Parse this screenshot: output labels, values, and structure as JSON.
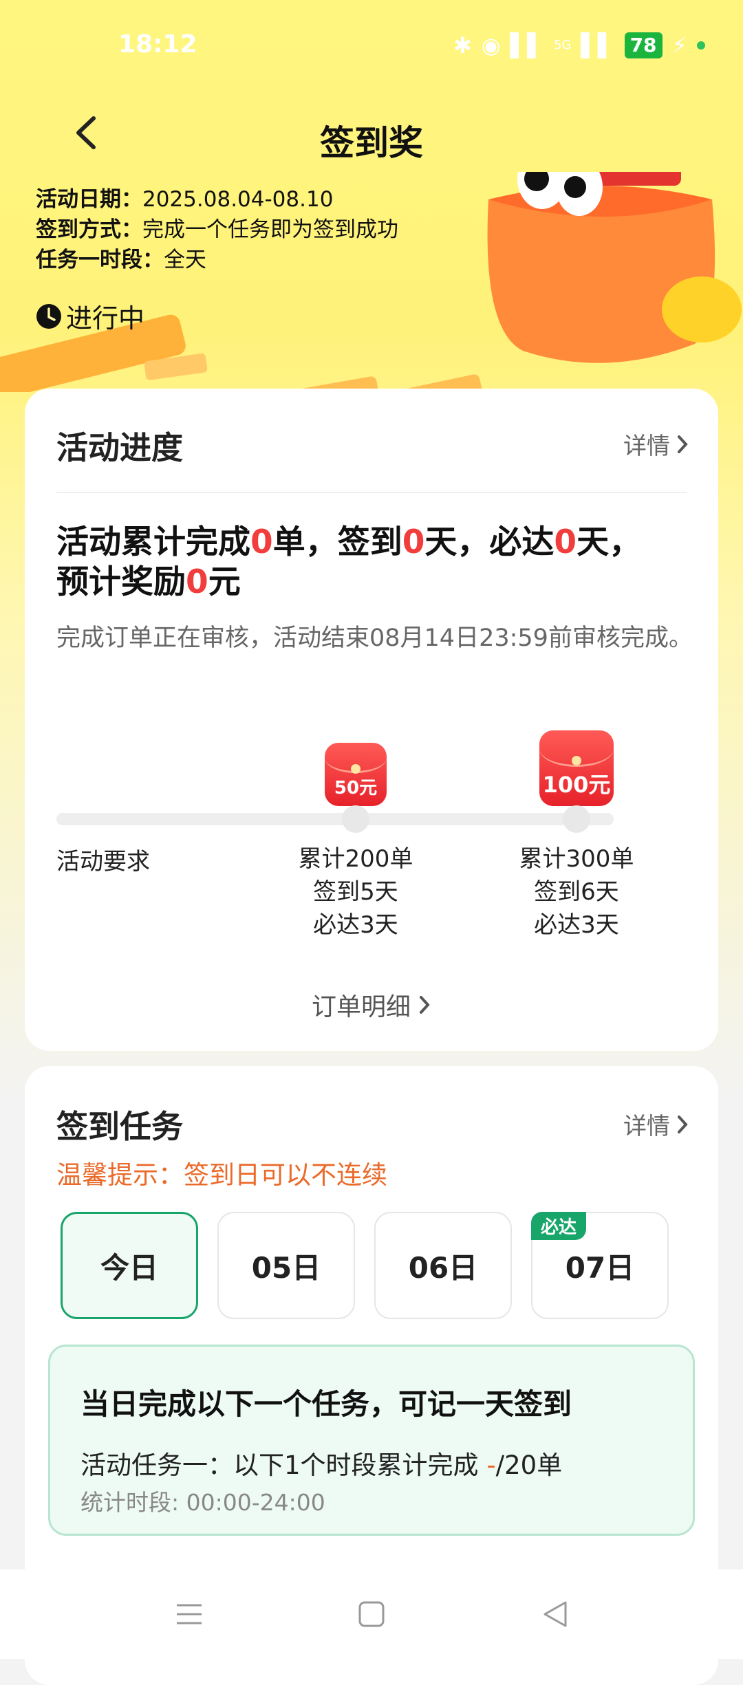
{
  "status_bar": {
    "time": "18:12",
    "battery": "78",
    "network": "5G"
  },
  "header": {
    "title": "签到奖"
  },
  "banner": {
    "date_label": "活动日期：",
    "date_value": "2025.08.04-08.10",
    "method_label": "签到方式：",
    "method_value": "完成一个任务即为签到成功",
    "period_label": "任务一时段：",
    "period_value": "全天",
    "status": "进行中"
  },
  "progress": {
    "title": "活动进度",
    "detail": "详情",
    "summary_parts": [
      "活动累计完成",
      "0",
      "单，签到",
      "0",
      "天，必达",
      "0",
      "天，",
      "预计奖励",
      "0",
      "元"
    ],
    "audit_note": "完成订单正在审核，活动结束08月14日23:59前审核完成。",
    "requirement_label": "活动要求",
    "milestones": [
      {
        "reward": "50元",
        "orders": "累计200单",
        "signin": "签到5天",
        "must": "必达3天"
      },
      {
        "reward": "100元",
        "orders": "累计300单",
        "signin": "签到6天",
        "must": "必达3天"
      }
    ],
    "order_detail": "订单明细"
  },
  "signin": {
    "title": "签到任务",
    "detail": "详情",
    "tip": "温馨提示：签到日可以不连续",
    "days": [
      {
        "label": "今日"
      },
      {
        "label": "05日"
      },
      {
        "label": "06日"
      },
      {
        "label": "07日",
        "badge": "必达"
      }
    ],
    "task_head": "当日完成以下一个任务，可记一天签到",
    "task_prefix": "活动任务一：以下1个时段累计完成 ",
    "task_progress": "-",
    "task_suffix": "/20单",
    "task_period": "统计时段: 00:00-24:00"
  },
  "colors": {
    "accent_red": "#f23d3d",
    "accent_green": "#18a56a",
    "tip_orange": "#ea6a2a",
    "banner_yellow": "#fff27a"
  }
}
